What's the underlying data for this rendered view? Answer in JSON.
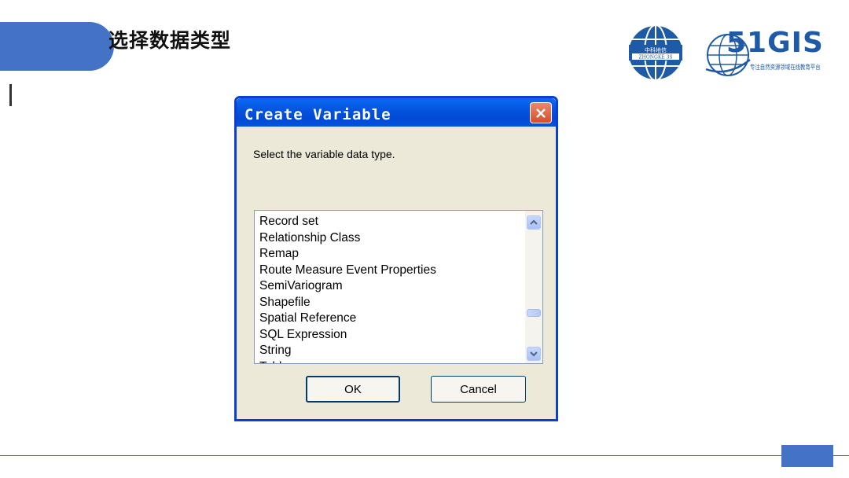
{
  "slide": {
    "title": "选择数据类型"
  },
  "logos": {
    "globe_text_top": "中科地信",
    "globe_text_bottom": "ZHONGKE 3S",
    "brand_51gis": "51GIS",
    "brand_subtitle": "专注自然资源领域在线教育平台"
  },
  "dialog": {
    "title": "Create Variable",
    "prompt": "Select the variable data type.",
    "list_items": [
      "Record set",
      "Relationship Class",
      "Remap",
      "Route Measure Event Properties",
      "SemiVariogram",
      "Shapefile",
      "Spatial Reference",
      "SQL Expression",
      "String",
      "Table"
    ],
    "ok_label": "OK",
    "cancel_label": "Cancel"
  },
  "colors": {
    "accent": "#4472c4",
    "xp_title_blue": "#0455e0",
    "close_red": "#d44f29",
    "dialog_bg": "#ece9d8"
  }
}
